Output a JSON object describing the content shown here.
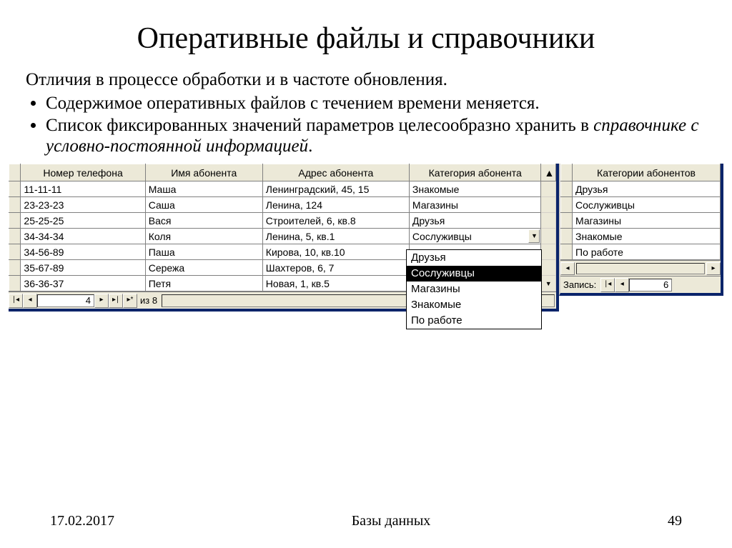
{
  "title": "Оперативные файлы и справочники",
  "intro": "Отличия в процессе обработки и в частоте обновления.",
  "bullets": [
    "Содержимое оперативных файлов с течением времени меняется.",
    "Список фиксированных значений параметров целесообразно хранить в "
  ],
  "bullet2_em": "справочнике с условно-постоянной информацией",
  "bullet2_tail": ".",
  "left_table": {
    "headers": [
      "Номер телефона",
      "Имя абонента",
      "Адрес абонента",
      "Категория абонента"
    ],
    "rows": [
      [
        "11-11-11",
        "Маша",
        "Ленинградский, 45, 15",
        "Знакомые"
      ],
      [
        "23-23-23",
        "Саша",
        "Ленина, 124",
        "Магазины"
      ],
      [
        "25-25-25",
        "Вася",
        "Строителей, 6, кв.8",
        "Друзья"
      ],
      [
        "34-34-34",
        "Коля",
        "Ленина, 5, кв.1",
        "Сослуживцы"
      ],
      [
        "34-56-89",
        "Паша",
        "Кирова, 10, кв.10",
        ""
      ],
      [
        "35-67-89",
        "Сережа",
        "Шахтеров, 6, 7",
        ""
      ],
      [
        "36-36-37",
        "Петя",
        "Новая, 1, кв.5",
        ""
      ]
    ],
    "nav_current": "4",
    "nav_of": "из 8"
  },
  "dropdown": {
    "options": [
      "Друзья",
      "Сослуживцы",
      "Магазины",
      "Знакомые",
      "По работе"
    ],
    "selected_index": 1
  },
  "right_table": {
    "header": "Категории абонентов",
    "rows": [
      "Друзья",
      "Сослуживцы",
      "Магазины",
      "Знакомые",
      "По работе"
    ],
    "nav_label": "Запись:",
    "nav_current": "6"
  },
  "footer": {
    "date": "17.02.2017",
    "title": "Базы данных",
    "page": "49"
  }
}
